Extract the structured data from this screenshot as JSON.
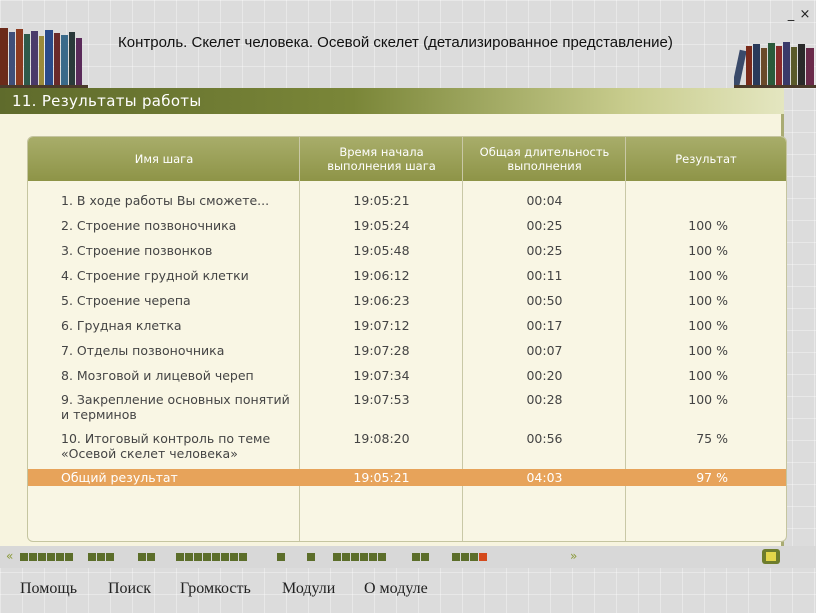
{
  "window": {
    "title": "Контроль. Скелет человека. Осевой скелет (детализированное представление)",
    "minimize_label": "_",
    "close_label": "×"
  },
  "section": {
    "title": "11. Результаты работы"
  },
  "table": {
    "headers": [
      "Имя шага",
      "Время начала выполнения шага",
      "Общая длительность выполнения",
      "Результат"
    ],
    "rows": [
      {
        "name": "1. В ходе работы Вы сможете...",
        "start": "19:05:21",
        "duration": "00:04",
        "result": ""
      },
      {
        "name": "2. Строение позвоночника",
        "start": "19:05:24",
        "duration": "00:25",
        "result": "100 %"
      },
      {
        "name": "3. Строение позвонков",
        "start": "19:05:48",
        "duration": "00:25",
        "result": "100 %"
      },
      {
        "name": "4. Строение грудной клетки",
        "start": "19:06:12",
        "duration": "00:11",
        "result": "100 %"
      },
      {
        "name": "5. Строение черепа",
        "start": "19:06:23",
        "duration": "00:50",
        "result": "100 %"
      },
      {
        "name": "6. Грудная клетка",
        "start": "19:07:12",
        "duration": "00:17",
        "result": "100 %"
      },
      {
        "name": "7. Отделы позвоночника",
        "start": "19:07:28",
        "duration": "00:07",
        "result": "100 %"
      },
      {
        "name": "8. Мозговой и лицевой череп",
        "start": "19:07:34",
        "duration": "00:20",
        "result": "100 %"
      },
      {
        "name": "9. Закрепление основных понятий и терминов",
        "start": "19:07:53",
        "duration": "00:28",
        "result": "100 %"
      },
      {
        "name": "10. Итоговый контроль по теме «Осевой скелет человека»",
        "start": "19:08:20",
        "duration": "00:56",
        "result": "75 %"
      }
    ],
    "total": {
      "name": "Общий результат",
      "start": "19:05:21",
      "duration": "04:03",
      "result": "97 %"
    }
  },
  "navigation": {
    "prev_icon": "double-chevron-left-icon",
    "next_icon": "double-chevron-right-icon",
    "save_icon": "floppy-disk-icon",
    "segments": [
      6,
      3,
      2,
      8,
      1,
      1,
      6,
      2,
      4
    ],
    "current_segment": 8,
    "current_index": 3,
    "active_color": "#5c6e2a",
    "current_color": "#d44a1c"
  },
  "menu": {
    "items": [
      "Помощь",
      "Поиск",
      "Громкость",
      "Модули",
      "О модуле"
    ]
  },
  "colors": {
    "header_bar": "#7a8638",
    "table_header": "#9aa055",
    "total_row": "#e7a35a"
  }
}
